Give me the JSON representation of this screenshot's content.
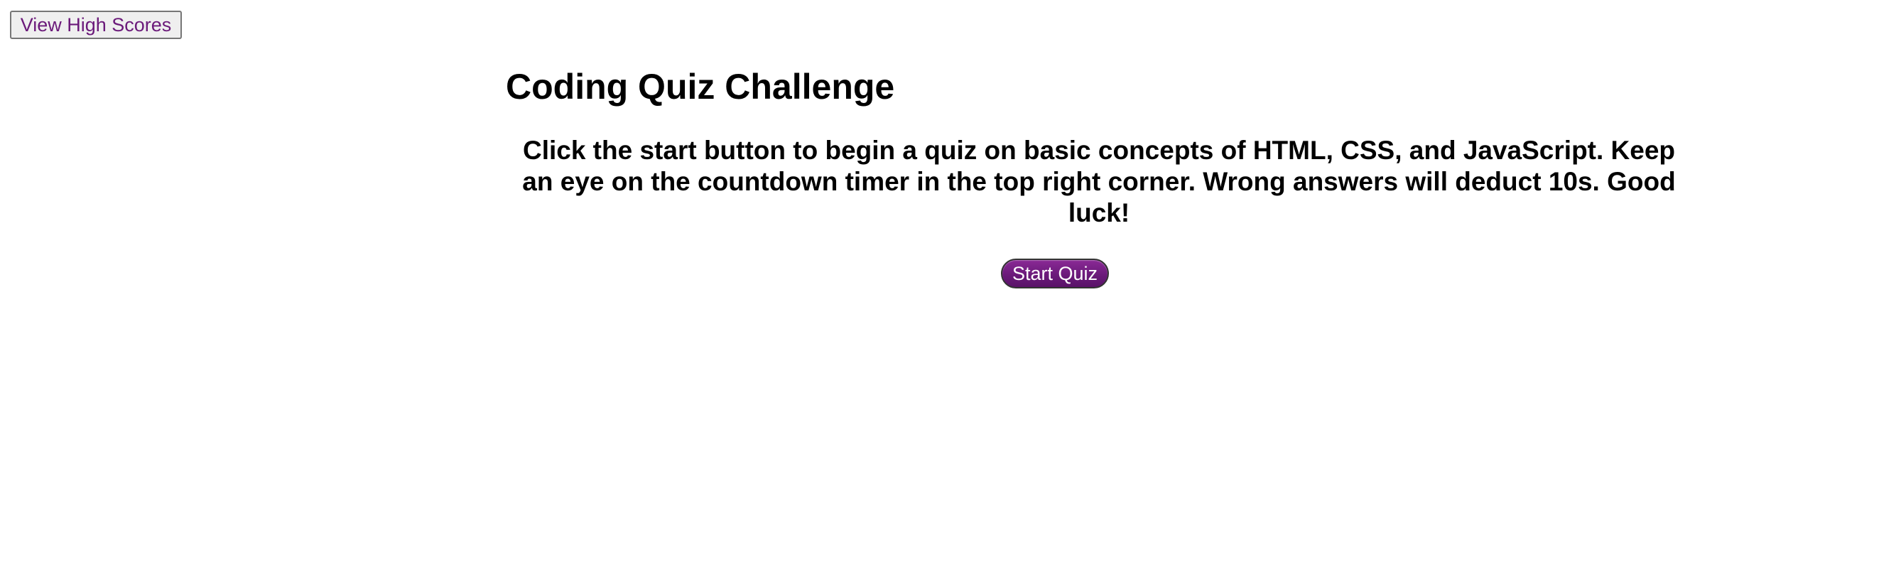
{
  "header": {
    "high_scores_label": "View High Scores"
  },
  "main": {
    "title": "Coding Quiz Challenge",
    "instructions": "Click the start button to begin a quiz on basic concepts of HTML, CSS, and JavaScript. Keep an eye on the countdown timer in the top right corner. Wrong answers will deduct 10s. Good luck!",
    "start_label": "Start Quiz"
  },
  "colors": {
    "accent": "#6b1a7a",
    "text": "#000000",
    "background": "#ffffff"
  }
}
